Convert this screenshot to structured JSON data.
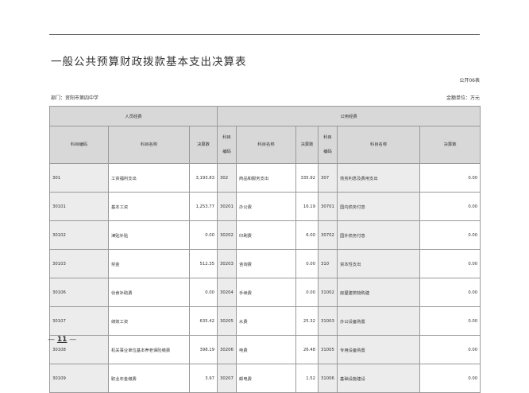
{
  "report": {
    "title": "一般公共预算财政拨款基本支出决算表",
    "form_no": "公开06表",
    "department": "部门：资阳市第四中学",
    "unit": "金额单位：万元",
    "page_number": "11"
  },
  "table": {
    "group_headers": {
      "personnel": "人员经费",
      "public": "公用经费"
    },
    "columns": {
      "code": "科目编码",
      "name": "科目名称",
      "amount": "决算数",
      "code_line1": "科目",
      "code_line2": "编码"
    },
    "rows": [
      {
        "c1": "301",
        "n1": "工资福利支出",
        "a1": "3,193.83",
        "c2": "302",
        "n2": "商品和服务支出",
        "a2": "335.92",
        "c3": "307",
        "n3": "债务利息及费用支出",
        "a3": "0.00"
      },
      {
        "c1": "30101",
        "n1": "基本工资",
        "a1": "1,253.77",
        "c2": "30201",
        "n2": "办公费",
        "a2": "16.19",
        "c3": "30701",
        "n3": "国内债务付息",
        "a3": "0.00"
      },
      {
        "c1": "30102",
        "n1": "津贴补贴",
        "a1": "0.00",
        "c2": "30202",
        "n2": "印刷费",
        "a2": "6.00",
        "c3": "30702",
        "n3": "国外债务付息",
        "a3": "0.00"
      },
      {
        "c1": "30103",
        "n1": "奖金",
        "a1": "512.35",
        "c2": "30203",
        "n2": "咨询费",
        "a2": "0.00",
        "c3": "310",
        "n3": "资本性支出",
        "a3": "0.00"
      },
      {
        "c1": "30106",
        "n1": "伙食补助费",
        "a1": "0.00",
        "c2": "30204",
        "n2": "手续费",
        "a2": "0.00",
        "c3": "31002",
        "n3": "房屋建筑物购建",
        "a3": "0.00"
      },
      {
        "c1": "30107",
        "n1": "绩效工资",
        "a1": "635.42",
        "c2": "30205",
        "n2": "水费",
        "a2": "25.32",
        "c3": "31003",
        "n3": "办公设备购置",
        "a3": "0.00"
      },
      {
        "c1": "30108",
        "n1": "机关事业单位基本养老保险缴费",
        "a1": "398.19",
        "c2": "30206",
        "n2": "电费",
        "a2": "26.48",
        "c3": "31005",
        "n3": "专用设备购置",
        "a3": "0.00"
      },
      {
        "c1": "30109",
        "n1": "职业年金缴费",
        "a1": "3.97",
        "c2": "30207",
        "n2": "邮电费",
        "a2": "1.52",
        "c3": "31006",
        "n3": "基础设施建设",
        "a3": "0.00"
      }
    ]
  }
}
